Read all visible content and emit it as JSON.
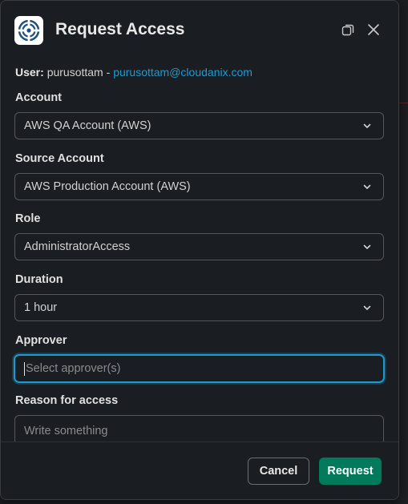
{
  "modal": {
    "title": "Request Access",
    "logo_icon": "cloudanix-logo",
    "header_icons": [
      "open-in-window-icon",
      "close-icon"
    ]
  },
  "user": {
    "label": "User:",
    "name": "purusottam",
    "separator": "-",
    "email": "purusottam@cloudanix.com"
  },
  "fields": {
    "account": {
      "label": "Account",
      "value": "AWS QA Account (AWS)"
    },
    "source_account": {
      "label": "Source Account",
      "value": "AWS Production Account (AWS)"
    },
    "role": {
      "label": "Role",
      "value": "AdministratorAccess"
    },
    "duration": {
      "label": "Duration",
      "value": "1 hour"
    },
    "approver": {
      "label": "Approver",
      "placeholder": "Select approver(s)",
      "value": ""
    },
    "reason": {
      "label": "Reason for access",
      "placeholder": "Write something"
    }
  },
  "footer": {
    "cancel_label": "Cancel",
    "request_label": "Request"
  },
  "colors": {
    "accent": "#1d9bd1",
    "primary_button": "#007a5a",
    "background": "#1a1d21"
  }
}
